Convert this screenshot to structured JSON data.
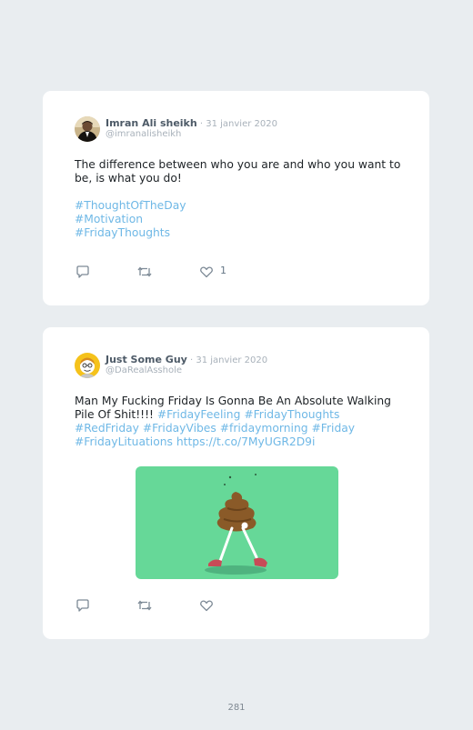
{
  "tweets": [
    {
      "author_name": "Imran Ali sheikh",
      "date": " · 31 janvier 2020",
      "handle": "@imranalisheikh",
      "text": "The difference between who you are and who you want to be, is what you do!",
      "hashtags": [
        "#ThoughtOfTheDay",
        "#Motivation",
        "#FridayThoughts"
      ],
      "like_count": "1"
    },
    {
      "author_name": "Just Some Guy",
      "date": " · 31 janvier 2020",
      "handle": "@DaRealAsshole",
      "text": "Man My Fucking Friday Is Gonna Be An Absolute Walking Pile Of Shit!!!!",
      "hashtags": [
        "#FridayFeeling",
        "#FridayThoughts",
        "#RedFriday",
        "#FridayVibes",
        "#fridaymorning",
        "#Friday",
        "#FridayLituations"
      ],
      "link": "https://t.co/7MyUGR2D9i",
      "like_count": ""
    }
  ],
  "page_number": "281",
  "colors": {
    "background": "#e9edf0",
    "card": "#ffffff",
    "hashtag": "#6fb8e6",
    "media_bg": "#66d898"
  }
}
